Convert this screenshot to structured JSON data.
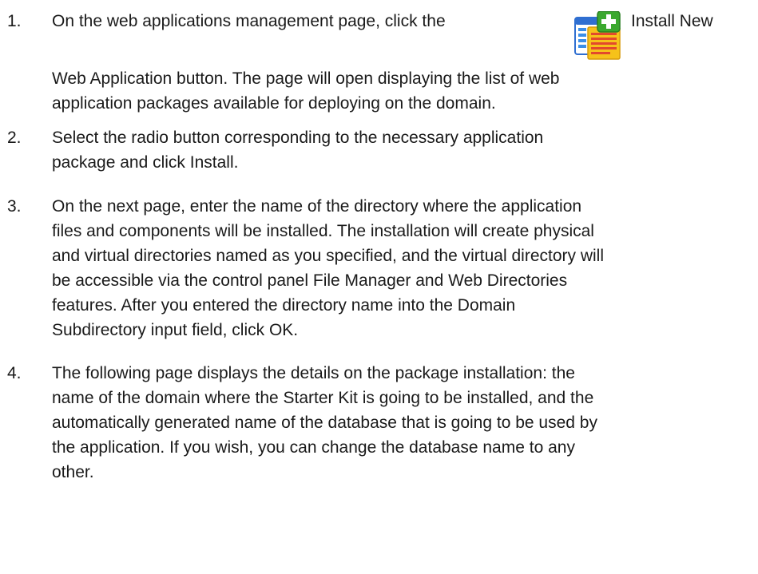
{
  "steps": [
    {
      "number": "1.",
      "line1_before": "On the web applications management page, click the",
      "line1_after": "Install New",
      "continuation": [
        "Web Application button. The page will open displaying the list of web",
        "application packages available for deploying on the domain."
      ],
      "icon": "install-new-web-application-icon"
    },
    {
      "number": "2.",
      "lines": [
        "Select the radio button corresponding to the necessary application",
        "package and click Install."
      ]
    },
    {
      "number": "3.",
      "lines": [
        "On the next page, enter the name of the directory where the application",
        "files and components will be installed. The installation will create physical",
        "and virtual directories named as you specified, and the virtual directory will",
        "be accessible via the control panel File Manager and Web Directories",
        "features. After you entered the directory name into the Domain",
        "Subdirectory input field, click OK."
      ]
    },
    {
      "number": "4.",
      "lines": [
        "The following page displays the details on the package installation: the",
        "name of the domain where the Starter Kit is going to be installed, and the",
        "automatically generated name of the database that is going to be used by",
        "the application. If you wish, you can change the database name to any",
        "other."
      ]
    }
  ],
  "colors": {
    "text": "#1a1a1a",
    "icon_blue": "#2f6fd1",
    "icon_green": "#3aa82e",
    "icon_yellow": "#f6c21a",
    "icon_red": "#e2492d"
  }
}
